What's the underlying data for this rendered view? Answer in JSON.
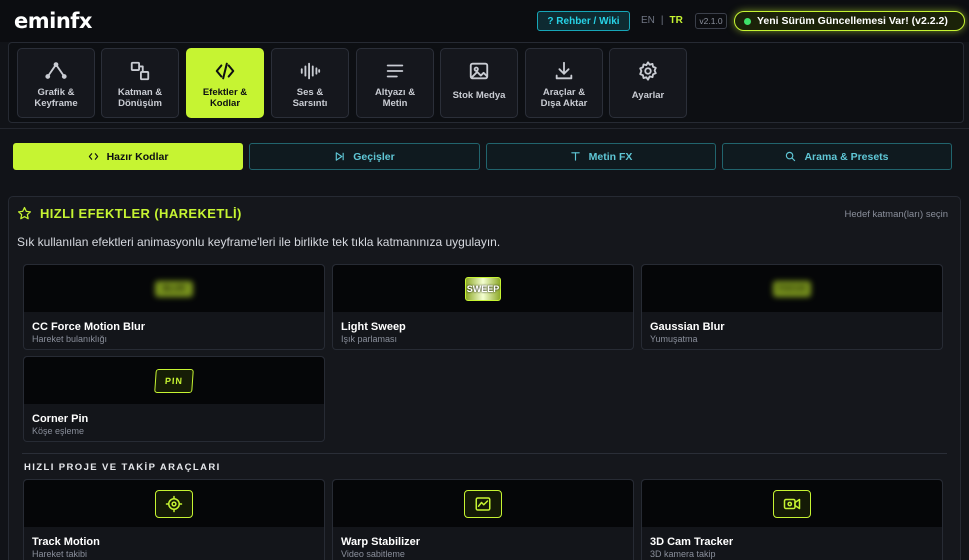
{
  "app": {
    "logo": "eminfx"
  },
  "header": {
    "help_label": "? Rehber / Wiki",
    "lang_en": "EN",
    "lang_sep": "|",
    "lang_tr": "TR",
    "version": "v2.1.0",
    "update_label": "Yeni Sürüm Güncellemesi Var! (v2.2.2)"
  },
  "nav": {
    "items": [
      {
        "label": "Grafik &\nKeyframe",
        "icon": "graph-icon"
      },
      {
        "label": "Katman &\nDönüşüm",
        "icon": "layers-icon"
      },
      {
        "label": "Efektler &\nKodlar",
        "icon": "code-icon",
        "active": true
      },
      {
        "label": "Ses &\nSarsıntı",
        "icon": "waveform-icon"
      },
      {
        "label": "Altyazı &\nMetin",
        "icon": "text-lines-icon"
      },
      {
        "label": "Stok Medya",
        "icon": "image-icon"
      },
      {
        "label": "Araçlar &\nDışa Aktar",
        "icon": "download-icon"
      },
      {
        "label": "Ayarlar",
        "icon": "gear-icon"
      }
    ]
  },
  "subtabs": [
    {
      "label": "Hazır Kodlar",
      "icon": "code-icon",
      "active": true
    },
    {
      "label": "Geçişler",
      "icon": "skip-icon"
    },
    {
      "label": "Metin FX",
      "icon": "type-icon"
    },
    {
      "label": "Arama & Presets",
      "icon": "search-icon"
    }
  ],
  "section": {
    "title": "HIZLI EFEKTLER (HAREKETLİ)",
    "hint": "Hedef katman(ları) seçin",
    "description": "Sık kullanılan efektleri animasyonlu keyframe'leri ile birlikte tek tıkla katmanınıza uygulayın."
  },
  "effects": [
    {
      "name": "CC Force Motion Blur",
      "sub": "Hareket bulanıklığı",
      "preview": "BLUR"
    },
    {
      "name": "Light Sweep",
      "sub": "Işık parlaması",
      "preview": "SWEEP"
    },
    {
      "name": "Gaussian Blur",
      "sub": "Yumuşatma",
      "preview": "FOCUS"
    },
    {
      "name": "Corner Pin",
      "sub": "Köşe eşleme",
      "preview": "PIN"
    }
  ],
  "section2": {
    "title": "HIZLI PROJE VE TAKİP ARAÇLARI"
  },
  "tools": [
    {
      "name": "Track Motion",
      "sub": "Hareket takibi",
      "icon": "crosshair-icon"
    },
    {
      "name": "Warp Stabilizer",
      "sub": "Video sabitleme",
      "icon": "stabilize-icon"
    },
    {
      "name": "3D Cam Tracker",
      "sub": "3D kamera takip",
      "icon": "video-camera-icon"
    }
  ],
  "colors": {
    "accent": "#c6f432",
    "cyan": "#27d2e6",
    "bg": "#111318"
  }
}
